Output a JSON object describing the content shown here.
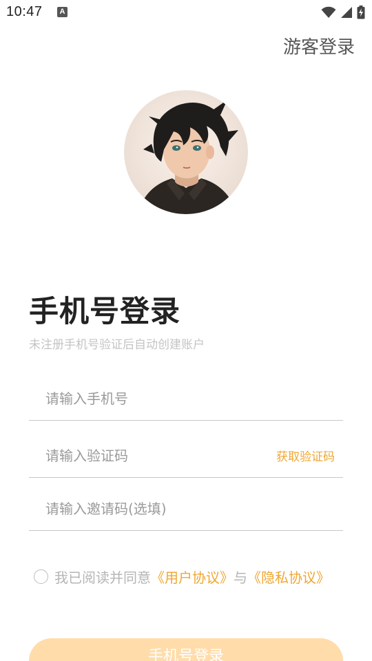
{
  "status_bar": {
    "time": "10:47",
    "notification_icon": "A",
    "icons": [
      "wifi-icon",
      "signal-icon",
      "battery-charging-icon"
    ]
  },
  "header": {
    "guest_login_label": "游客登录"
  },
  "avatar": {
    "icon": "avatar-illustration"
  },
  "main": {
    "title": "手机号登录",
    "subtitle": "未注册手机号验证后自动创建账户"
  },
  "form": {
    "phone_placeholder": "请输入手机号",
    "code_placeholder": "请输入验证码",
    "get_code_label": "获取验证码",
    "invite_placeholder": "请输入邀请码(选填)"
  },
  "agreement": {
    "prefix": "我已阅读并同意",
    "user_agreement": "《用户协议》",
    "conjunction": "与",
    "privacy_policy": "《隐私协议》"
  },
  "login_button": {
    "label": "手机号登录"
  },
  "colors": {
    "accent": "#f0a731",
    "button_bg": "#ffdcaa",
    "title": "#222222",
    "hint": "#c4c4c4"
  }
}
